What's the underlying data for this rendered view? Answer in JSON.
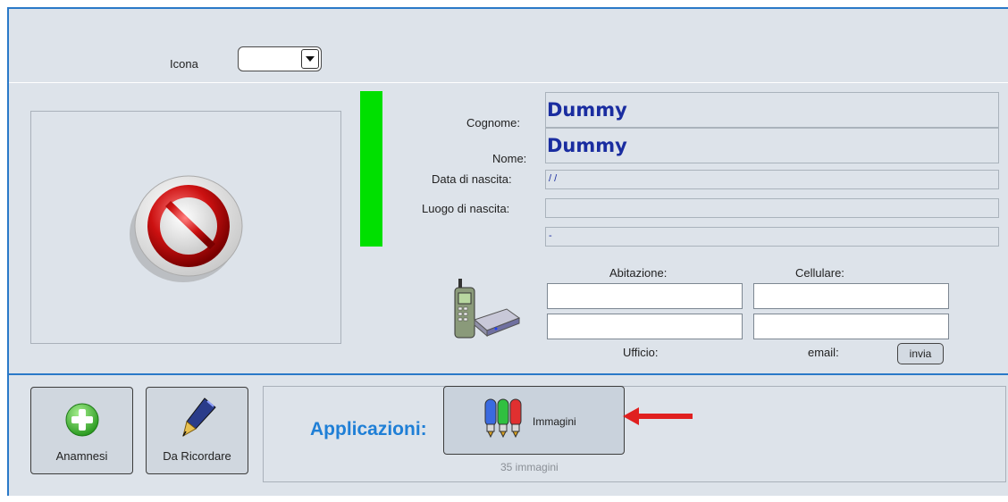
{
  "header": {
    "icona_label": "Icona",
    "icona_value": ""
  },
  "patient": {
    "cognome_label": "Cognome:",
    "cognome_value": "Dummy",
    "nome_label": "Nome:",
    "nome_value": "Dummy",
    "data_label": "Data di nascita:",
    "data_value": " / /",
    "luogo_label": "Luogo di nascita:",
    "luogo_value": "",
    "extra_value": "-"
  },
  "contacts": {
    "abitazione_label": "Abitazione:",
    "cellulare_label": "Cellulare:",
    "ufficio_label": "Ufficio:",
    "email_label": "email:",
    "invia_label": "invia",
    "abitazione_value": "",
    "cellulare_value": "",
    "ufficio_value": "",
    "email_value": ""
  },
  "actions": {
    "anamnesi_label": "Anamnesi",
    "da_ricordare_label": "Da Ricordare",
    "applicazioni_label": "Applicazioni:",
    "immagini_label": "Immagini",
    "immagini_count": "35 immagini"
  },
  "colors": {
    "accent": "#2a79c8",
    "status_green": "#00e000",
    "name_text": "#1a2da0",
    "arrow": "#e02020"
  },
  "icons": [
    "no-entry-icon",
    "phone-modem-icon",
    "add-icon",
    "pen-icon",
    "paint-tubes-icon",
    "red-arrow-icon",
    "dropdown-arrow-icon"
  ]
}
